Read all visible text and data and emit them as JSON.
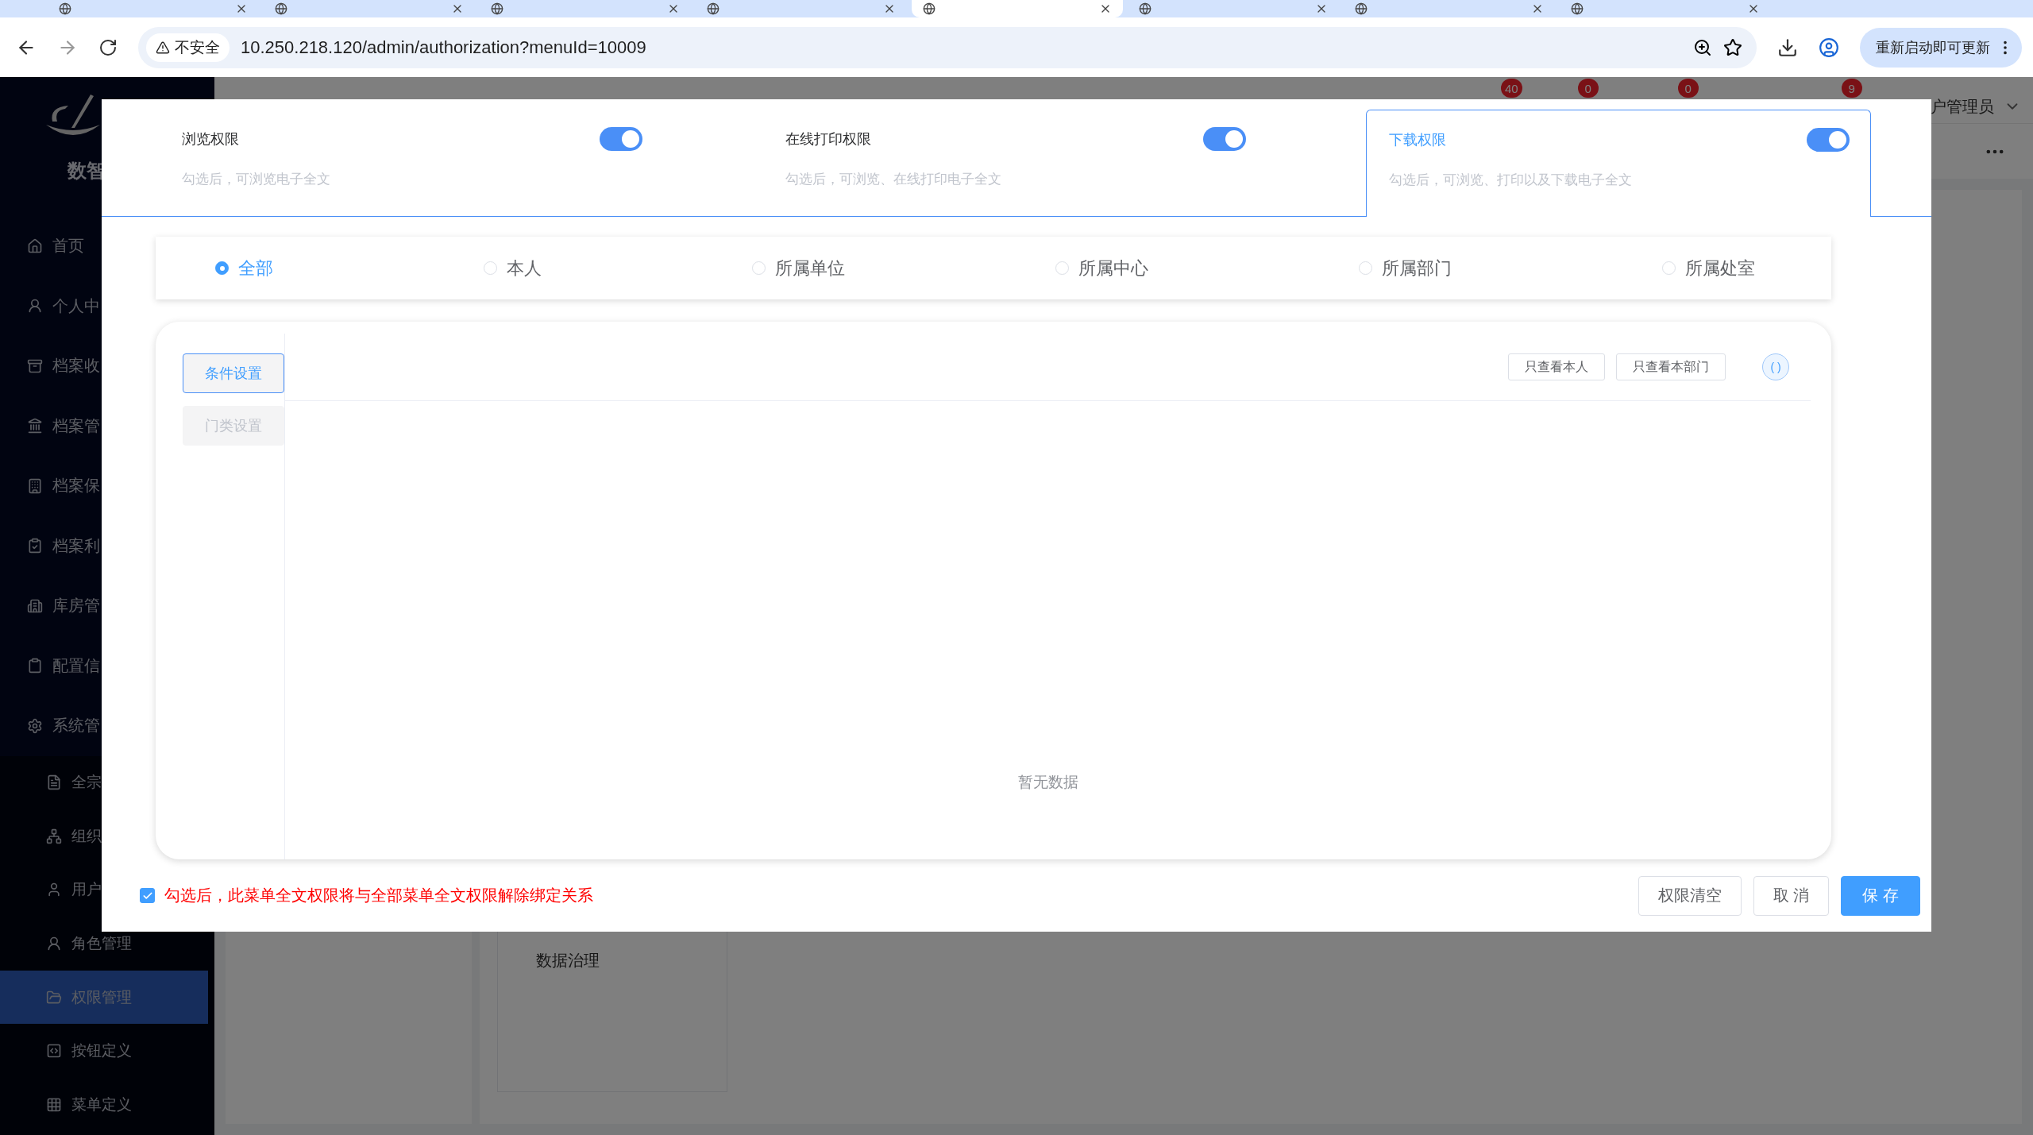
{
  "browser": {
    "tabs": [
      {
        "selected": false
      },
      {
        "selected": false
      },
      {
        "selected": false
      },
      {
        "selected": false
      },
      {
        "selected": true
      },
      {
        "selected": false
      },
      {
        "selected": false
      },
      {
        "selected": false
      }
    ],
    "security_label": "不安全",
    "url": "10.250.218.120/admin/authorization?menuId=10009",
    "update_button": "重新启动即可更新"
  },
  "sidebar": {
    "logo_text": "数智",
    "items": [
      {
        "label": "首页"
      },
      {
        "label": "个人中"
      },
      {
        "label": "档案收"
      },
      {
        "label": "档案管"
      },
      {
        "label": "档案保"
      },
      {
        "label": "档案利"
      },
      {
        "label": "库房管"
      },
      {
        "label": "配置信"
      },
      {
        "label": "系统管"
      }
    ],
    "submenu": [
      {
        "label": "全宗",
        "selected": false
      },
      {
        "label": "组织",
        "selected": false
      },
      {
        "label": "用户",
        "selected": false
      },
      {
        "label": "角色管理",
        "selected": false
      },
      {
        "label": "权限管理",
        "selected": true
      },
      {
        "label": "按钮定义",
        "selected": false
      },
      {
        "label": "菜单定义",
        "selected": false
      }
    ]
  },
  "header": {
    "badges": [
      "40",
      "0",
      "0",
      "9"
    ],
    "user": "户管理员"
  },
  "background": {
    "panel_text": "数据治理"
  },
  "modal": {
    "permission_tabs": [
      {
        "title": "浏览权限",
        "description": "勾选后，可浏览电子全文",
        "on": true,
        "selected": false
      },
      {
        "title": "在线打印权限",
        "description": "勾选后，可浏览、在线打印电子全文",
        "on": true,
        "selected": false
      },
      {
        "title": "下载权限",
        "description": "勾选后，可浏览、打印以及下载电子全文",
        "on": true,
        "selected": true
      }
    ],
    "scopes": [
      {
        "label": "全部",
        "selected": true
      },
      {
        "label": "本人",
        "selected": false
      },
      {
        "label": "所属单位",
        "selected": false
      },
      {
        "label": "所属中心",
        "selected": false
      },
      {
        "label": "所属部门",
        "selected": false
      },
      {
        "label": "所属处室",
        "selected": false
      }
    ],
    "side_tabs": [
      {
        "label": "条件设置",
        "selected": true,
        "disabled": false
      },
      {
        "label": "门类设置",
        "selected": false,
        "disabled": true
      }
    ],
    "filter_buttons": [
      "只查看本人",
      "只查看本部门"
    ],
    "info_button": "( )",
    "empty_text": "暂无数据",
    "unbind": {
      "checked": true,
      "label": "勾选后，此菜单全文权限将与全部菜单全文权限解除绑定关系"
    },
    "buttons": [
      {
        "label": "权限清空",
        "kind": "default"
      },
      {
        "label": "取 消",
        "kind": "default"
      },
      {
        "label": "保 存",
        "kind": "primary"
      }
    ]
  }
}
